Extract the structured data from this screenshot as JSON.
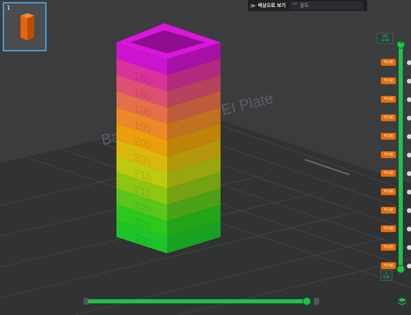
{
  "thumbnail": {
    "index": "1",
    "color": "#e8650a"
  },
  "toolbar": {
    "collapse_icon": "chevron-double-down-icon",
    "view_label": "색상으로 보기",
    "view_value": "온도",
    "dropdown_icon": "chevron-down-icon"
  },
  "model": {
    "text_surface": "Bambu Textured PEI Plate",
    "temperature_labels": [
      "230",
      "225",
      "220",
      "215",
      "210",
      "205",
      "200",
      "195",
      "190",
      "185",
      "180"
    ],
    "gradient_colors": [
      "#1ec42a",
      "#2bc81e",
      "#5bc61a",
      "#8ec613",
      "#bccb10",
      "#dcb80c",
      "#e9a00a",
      "#eb8a26",
      "#e57048",
      "#de5072",
      "#d9339a",
      "#cc14cc"
    ]
  },
  "layer_slider": {
    "top_badge": "195\n12.60",
    "bottom_badge": "1\n0.20",
    "marker_label": "커스텀",
    "marker_count": 12,
    "accent_color": "#1ec24a",
    "marker_color": "#e36c0a"
  },
  "move_slider": {
    "accent_color": "#1ec24a"
  }
}
